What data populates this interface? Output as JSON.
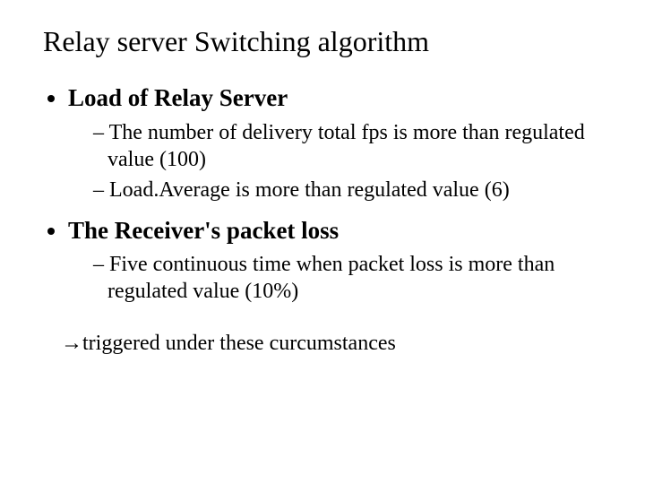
{
  "title": "Relay server Switching algorithm",
  "bullets": [
    {
      "label": "Load of Relay Server",
      "subs": [
        "The number of delivery total fps is more than regulated value (100)",
        "Load.Average is more than regulated value (6)"
      ]
    },
    {
      "label": "The Receiver's packet loss",
      "subs": [
        "Five continuous time when packet loss is more than regulated value (10%)"
      ]
    }
  ],
  "footer": "→triggered under these curcumstances"
}
